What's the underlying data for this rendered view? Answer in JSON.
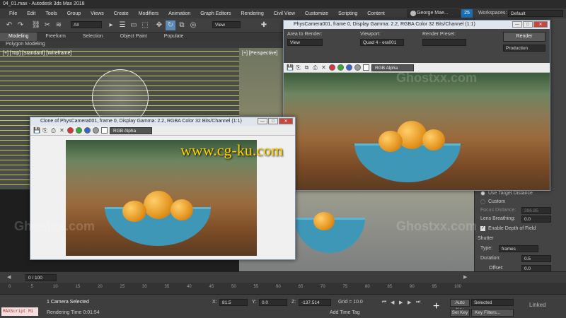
{
  "window_title": "04_01.max - Autodesk 3ds Max 2018",
  "menu": [
    "File",
    "Edit",
    "Tools",
    "Group",
    "Views",
    "Create",
    "Modifiers",
    "Animation",
    "Graph Editors",
    "Rendering",
    "Civil View",
    "Customize",
    "Scripting",
    "Content"
  ],
  "user": "George Mae...",
  "notif_count": "25",
  "workspaces_label": "Workspaces:",
  "workspace_value": "Default",
  "toolbar": {
    "selection_filter": "All",
    "ref_coord": "View"
  },
  "ribbon_tabs": [
    "Modeling",
    "Freeform",
    "Selection",
    "Object Paint",
    "Populate"
  ],
  "ribbon_sub": "Polygon Modeling",
  "viewports": {
    "top_label": "[+] [Top] [Standard] [Wireframe]",
    "persp_label": "[+] [Perspective]"
  },
  "render_main": {
    "title": "PhysCamera001, frame 0, Display Gamma: 2.2, RGBA Color 32 Bits/Channel (1:1)",
    "area_label": "Area to Render:",
    "area_value": "View",
    "viewport_label": "Viewport:",
    "viewport_value": "Quad 4 - era001",
    "preset_label": "Render Preset:",
    "render_button": "Render",
    "production": "Production",
    "channel": "RGB Alpha"
  },
  "render_clone": {
    "title": "Clone of PhysCamera001, frame 0, Display Gamma: 2.2, RGBA Color 32 Bits/Channel (1:1)",
    "channel": "RGB Alpha"
  },
  "cmd_panel": {
    "use_target_distance": "Use Target Distance",
    "custom": "Custom",
    "focus_distance_label": "Focus Distance:",
    "focus_distance_value": "396.85",
    "lens_breathing_label": "Lens Breathing:",
    "lens_breathing_value": "0.0",
    "enable_dof": "Enable Depth of Field",
    "shutter": "Shutter",
    "type_label": "Type:",
    "type_value": "frames",
    "duration_label": "Duration:",
    "duration_value": "0.5",
    "offset_label": "Offset:",
    "offset_value": "0.0"
  },
  "timeline": {
    "frame": "0 / 100",
    "ticks": [
      "0",
      "5",
      "10",
      "15",
      "20",
      "25",
      "30",
      "35",
      "40",
      "45",
      "50",
      "55",
      "60",
      "65",
      "70",
      "75",
      "80",
      "85",
      "90",
      "95",
      "100"
    ]
  },
  "status": {
    "maxscript": "MAXScript Mi",
    "selected": "1 Camera Selected",
    "render_time": "Rendering Time  0:01:54",
    "x_label": "X:",
    "x_value": "81.5",
    "y_label": "Y:",
    "y_value": "0.0",
    "z_label": "Z:",
    "z_value": "-137.514",
    "grid": "Grid = 10.0",
    "add_time_tag": "Add Time Tag",
    "auto_key": "Auto Key",
    "selected_dd": "Selected",
    "set_key": "Set Key",
    "key_filters": "Key Filters..."
  },
  "overlay": {
    "cgku": "www.cg-ku.com",
    "ghostxx": "Ghostxx.com",
    "linked": "Linked"
  }
}
